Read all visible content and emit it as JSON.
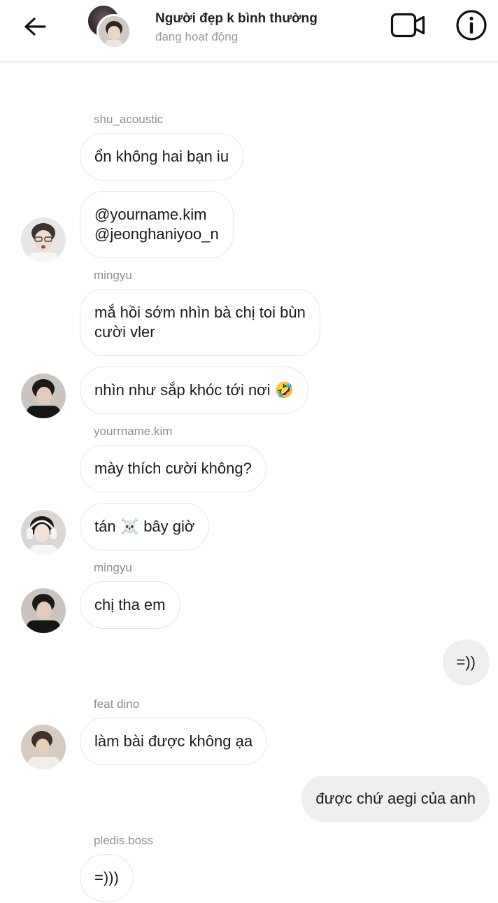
{
  "header": {
    "title": "Người đẹp k bình thường",
    "status": "đang hoạt động",
    "icons": {
      "back": "arrow-left-icon",
      "video": "video-camera-icon",
      "info": "info-icon"
    }
  },
  "messages": [
    {
      "sender": "shu_acoustic",
      "lines": [
        "ổn không hai bạn iu"
      ]
    },
    {
      "lines": [
        "@yourname.kim",
        "@jeonghaniyoo_n"
      ]
    },
    {
      "sender": "mingyu",
      "lines": [
        "mắ hồi sớm nhìn bà chị toi bùn",
        "cười vler"
      ]
    },
    {
      "lines": [
        "nhìn như sắp khóc tới nơi 🤣"
      ]
    },
    {
      "sender": "yourrname.kim",
      "lines": [
        "mày thích cười không?"
      ]
    },
    {
      "lines": [
        "tán ☠️ bây giờ"
      ]
    },
    {
      "sender": "mingyu",
      "lines": [
        "chị tha em"
      ]
    },
    {
      "outgoing": true,
      "lines": [
        "=))"
      ]
    },
    {
      "sender": "feat dino",
      "lines": [
        "làm bài được không ạa"
      ]
    },
    {
      "outgoing": true,
      "lines": [
        "được chứ aegi của anh"
      ]
    },
    {
      "sender": "pledis.boss",
      "lines": [
        "=)))"
      ]
    }
  ],
  "colors": {
    "bubble_border": "#e6e6e6",
    "outgoing_bubble": "#efefef",
    "muted_text": "#8e8e8e"
  }
}
